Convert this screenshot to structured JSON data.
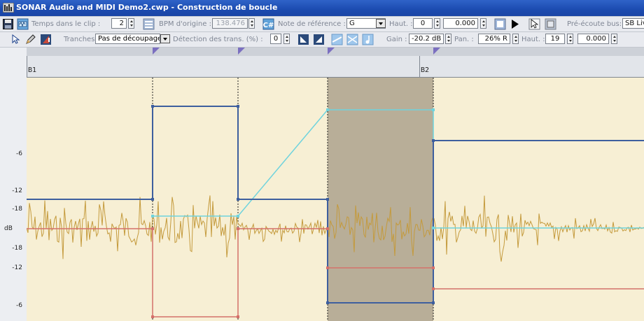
{
  "window": {
    "title": "SONAR Audio and MIDI Demo2.cwp - Construction de boucle"
  },
  "toolbar1": {
    "beats_label": "Temps dans le clip :",
    "beats_value": "2",
    "bpm_label": "BPM d'origine :",
    "bpm_value": "138.476",
    "ref_note_label": "Note de référence :",
    "ref_note_value": "G",
    "pitch_label": "Haut. :",
    "pitch_value": "0",
    "fine_value": "0.000",
    "preview_bus_label": "Pré-écoute bus:",
    "preview_bus_value": "SB Live"
  },
  "toolbar2": {
    "slices_label": "Tranches",
    "slices_value": "Pas de découpage",
    "transient_label": "Détection des trans. (%) :",
    "transient_value": "0",
    "gain_label": "Gain :",
    "gain_value": "-20.2 dB",
    "pan_label": "Pan. :",
    "pan_value": "26% R",
    "pitch_label": "Haut. :",
    "pitch_value": "19",
    "fine_value": "0.000"
  },
  "ruler": {
    "markers": [
      "B1",
      "B2"
    ]
  },
  "db_scale": [
    "-6",
    "-12",
    "-18",
    "dB",
    "-18",
    "-12",
    "-6"
  ],
  "colors": {
    "background": "#f7efd4",
    "selection": "#b8ae98",
    "waveform": "#c49a3c",
    "envelope_blue": "#3e5f9e",
    "envelope_cyan": "#6fd3dd",
    "envelope_red": "#d4706a"
  }
}
